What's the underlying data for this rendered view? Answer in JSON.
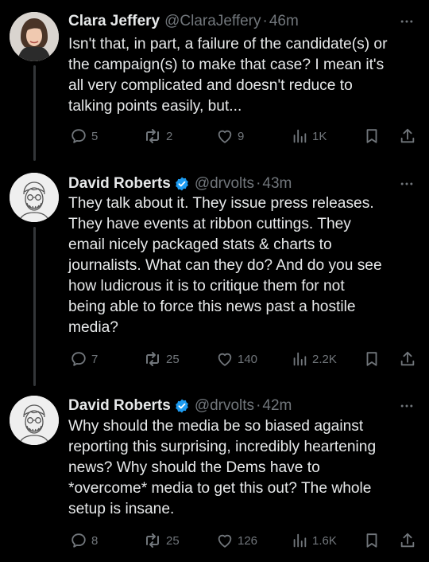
{
  "tweets": [
    {
      "name": "Clara Jeffery",
      "handle": "@ClaraJeffery",
      "separator": "·",
      "time": "46m",
      "verified": false,
      "text": "Isn't that, in part, a failure of the candidate(s) or\nthe campaign(s) to make that case? I mean it's\nall very complicated and doesn't reduce to\ntalking points easily, but...",
      "replies": "5",
      "reposts": "2",
      "likes": "9",
      "views": "1K"
    },
    {
      "name": "David Roberts",
      "handle": "@drvolts",
      "separator": "·",
      "time": "43m",
      "verified": true,
      "text": "They talk about it. They issue press releases.\nThey have events at ribbon cuttings. They\nemail nicely packaged stats & charts to\njournalists. What can they do? And do you see\nhow ludicrous it is to critique them for not\nbeing able to force this news past a hostile\nmedia?",
      "replies": "7",
      "reposts": "25",
      "likes": "140",
      "views": "2.2K"
    },
    {
      "name": "David Roberts",
      "handle": "@drvolts",
      "separator": "·",
      "time": "42m",
      "verified": true,
      "text": "Why should the media be so biased against\nreporting this surprising, incredibly heartening\nnews? Why should the Dems have to\n*overcome* media to get this out? The whole\nsetup is insane.",
      "replies": "8",
      "reposts": "25",
      "likes": "126",
      "views": "1.6K"
    }
  ],
  "icons": {
    "reply": "reply-icon",
    "repost": "repost-icon",
    "like": "heart-icon",
    "views": "views-icon",
    "bookmark": "bookmark-icon",
    "share": "share-icon",
    "more": "more-icon",
    "verified": "verified-badge-icon"
  },
  "colors": {
    "background": "#000000",
    "text": "#e7e9ea",
    "muted": "#71767b",
    "verified": "#1d9bf0"
  }
}
